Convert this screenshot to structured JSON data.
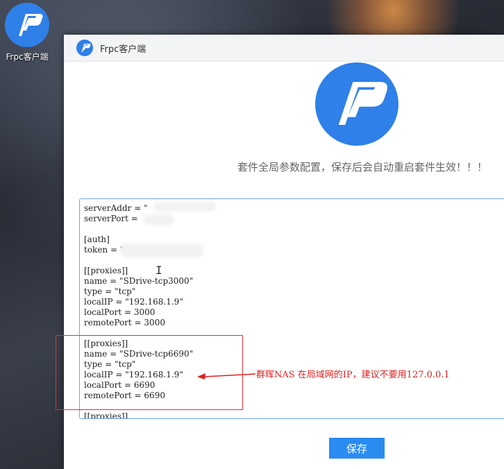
{
  "desktop": {
    "icon_label": "Frpc客户端"
  },
  "window": {
    "title": "Frpc客户端",
    "subtitle": "套件全局参数配置，保存后会自动重启套件生效！！！",
    "config_lines": [
      "serverAddr = \"",
      "serverPort = ",
      "",
      "[auth]",
      "token = \"",
      "",
      "[[proxies]]",
      "name = \"SDrive-tcp3000\"",
      "type = \"tcp\"",
      "localIP = \"192.168.1.9\"",
      "localPort = 3000",
      "remotePort = 3000",
      "",
      "[[proxies]]",
      "name = \"SDrive-tcp6690\"",
      "type = \"tcp\"",
      "localIP = \"192.168.1.9\"",
      "localPort = 6690",
      "remotePort = 6690",
      "",
      "[[proxies]]"
    ],
    "save_label": "保存"
  },
  "annotation": {
    "text": "群晖NAS 在局域网的IP，建议不要用127.0.0.1",
    "color": "#e02020"
  },
  "colors": {
    "brand": "#2f80e8",
    "button": "#2a8cf0"
  },
  "icons": {
    "app_logo": "frpc-logo-icon",
    "text_cursor": "ibeam-cursor-icon"
  }
}
